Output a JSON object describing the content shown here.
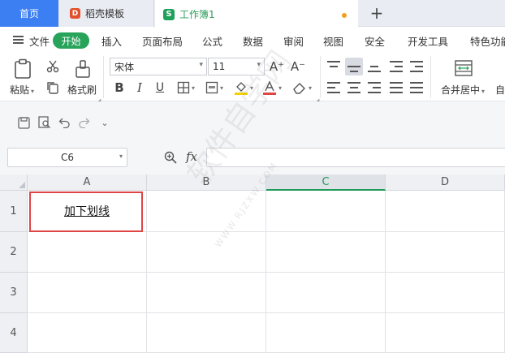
{
  "tabs": {
    "home": "首页",
    "docer": "稻壳模板",
    "docer_logo": "D",
    "workbook": "工作簿1",
    "workbook_logo": "S",
    "new_tab": "+"
  },
  "menu": {
    "file": "文件",
    "start": "开始",
    "items": [
      "插入",
      "页面布局",
      "公式",
      "数据",
      "审阅",
      "视图",
      "安全",
      "开发工具",
      "特色功能"
    ]
  },
  "ribbon": {
    "paste": "粘贴",
    "format_painter": "格式刷",
    "font_name": "宋体",
    "font_size": "11",
    "bold": "B",
    "italic": "I",
    "underline": "U",
    "grow_font": "A⁺",
    "shrink_font": "A⁻",
    "merge_center": "合并居中",
    "auto_wrap": "自"
  },
  "formula_bar": {
    "name_box": "C6",
    "fx": "fx",
    "formula": ""
  },
  "sheet": {
    "columns": [
      "A",
      "B",
      "C",
      "D"
    ],
    "active_column": "C",
    "rows": [
      "1",
      "2",
      "3",
      "4"
    ],
    "cells": {
      "A1": "加下划线"
    }
  },
  "watermark": {
    "text": "软件自学网",
    "url": "WWW.RJZXW.COM"
  },
  "colors": {
    "accent_blue": "#3b7ff2",
    "accent_green": "#27a35a",
    "highlight_red": "#e04545",
    "font_color_bar": "#e04545",
    "fill_color_bar": "#f5d000"
  }
}
